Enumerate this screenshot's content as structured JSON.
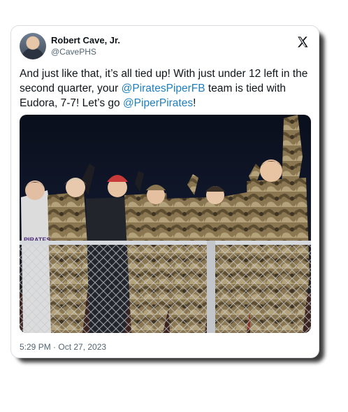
{
  "author": {
    "name": "Robert Cave, Jr.",
    "handle": "@CavePHS"
  },
  "tweet": {
    "text_part1": "And just like that, it’s all tied up! With just under 12 left in the second quarter, your ",
    "mention1": "@PiratesPiperFB",
    "text_part2": " team is tied with Eudora, 7-7! Let’s go ",
    "mention2": "@PiperPirates",
    "text_part3": "!",
    "timestamp": "5:29 PM · Oct 27, 2023"
  },
  "photo": {
    "shirt_text": "PIRATES"
  },
  "icons": {
    "x_logo": "x-logo-icon"
  }
}
